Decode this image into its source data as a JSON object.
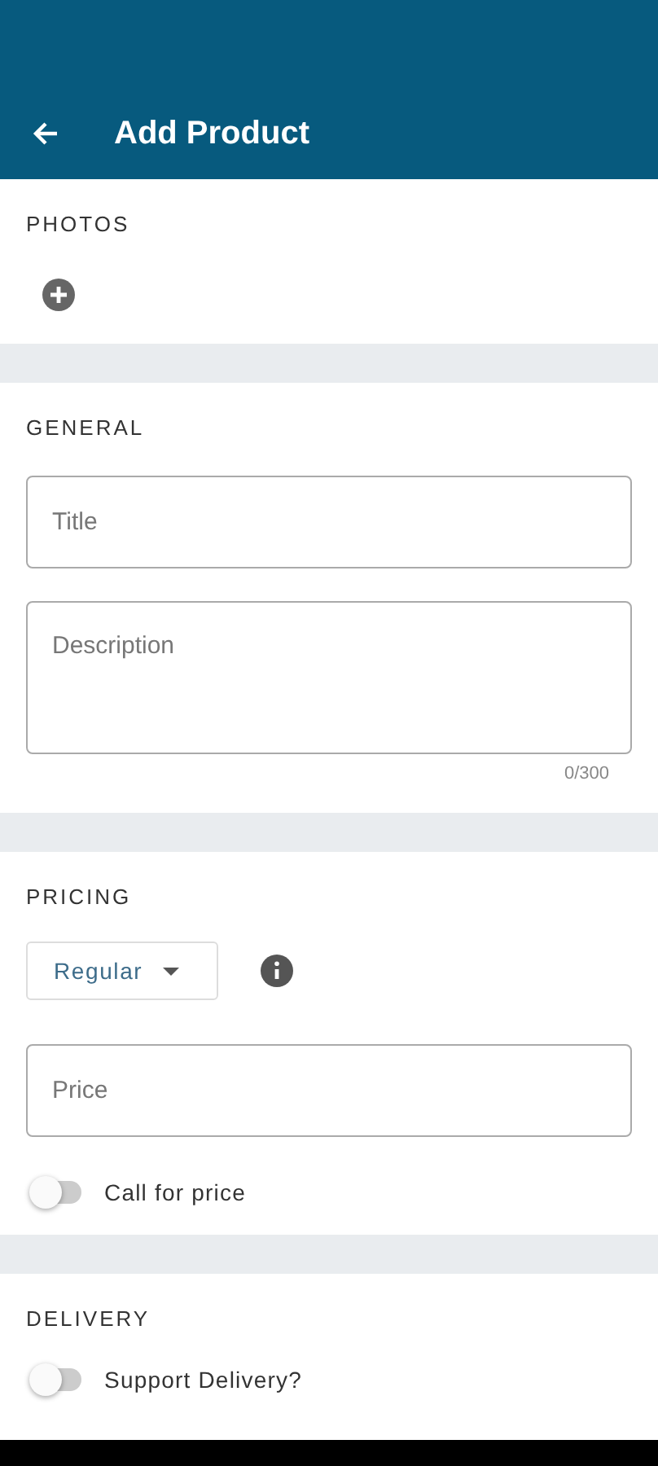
{
  "app_bar": {
    "title": "Add Product"
  },
  "photos": {
    "heading": "PHOTOS"
  },
  "general": {
    "heading": "GENERAL",
    "fields": [
      {
        "kind": "line",
        "placeholder": "Title"
      },
      {
        "kind": "multiline",
        "placeholder": "Description"
      }
    ],
    "counter": "0/300"
  },
  "pricing": {
    "heading": "PRICING",
    "dropdown": "Regular",
    "price": {
      "placeholder": "Price"
    },
    "toggle": {
      "label": "Call for price",
      "on": false
    }
  },
  "delivery": {
    "heading": "DELIVERY",
    "toggle": {
      "label": "Support Delivery?",
      "on": false
    }
  }
}
